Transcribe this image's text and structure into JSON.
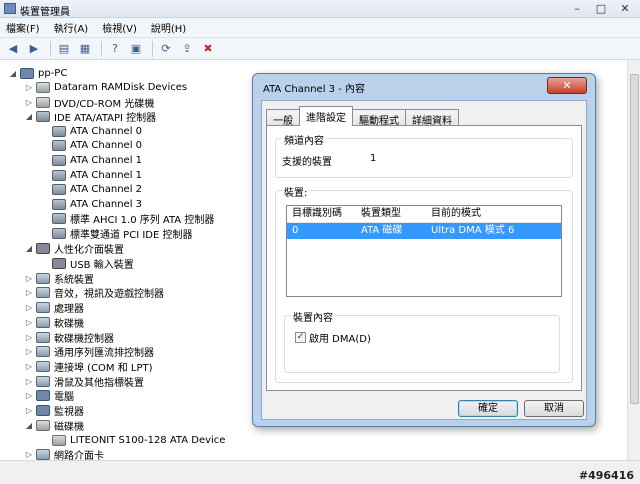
{
  "window": {
    "title": "裝置管理員",
    "controls": [
      "–",
      "□",
      "✕"
    ]
  },
  "menu": [
    "檔案(F)",
    "執行(A)",
    "檢視(V)",
    "說明(H)"
  ],
  "toolbar": {
    "icons": [
      "back-icon",
      "forward-icon",
      "view-icon",
      "properties-icon",
      "help-icon",
      "device-icon",
      "scan-icon",
      "update-driver-icon",
      "uninstall-icon"
    ]
  },
  "tree": {
    "root": "pp-PC",
    "items": [
      {
        "label": "Dataram RAMDisk Devices"
      },
      {
        "label": "DVD/CD-ROM 光碟機"
      },
      {
        "label": "IDE ATA/ATAPI 控制器"
      },
      {
        "label": "ATA Channel 0"
      },
      {
        "label": "ATA Channel 0"
      },
      {
        "label": "ATA Channel 1"
      },
      {
        "label": "ATA Channel 1"
      },
      {
        "label": "ATA Channel 2"
      },
      {
        "label": "ATA Channel 3"
      },
      {
        "label": "標準 AHCI 1.0 序列 ATA 控制器"
      },
      {
        "label": "標準雙通道 PCI IDE 控制器"
      },
      {
        "label": "人性化介面裝置"
      },
      {
        "label": "USB 輸入裝置"
      },
      {
        "label": "系統裝置"
      },
      {
        "label": "音效，視訊及遊戲控制器"
      },
      {
        "label": "處理器"
      },
      {
        "label": "軟碟機"
      },
      {
        "label": "軟碟機控制器"
      },
      {
        "label": "通用序列匯流排控制器"
      },
      {
        "label": "連接埠 (COM 和 LPT)"
      },
      {
        "label": "滑鼠及其他指標裝置"
      },
      {
        "label": "電腦"
      },
      {
        "label": "監視器"
      },
      {
        "label": "磁碟機"
      },
      {
        "label": "LITEONIT S100-128 ATA Device"
      },
      {
        "label": "網路介面卡"
      }
    ]
  },
  "dialog": {
    "title": "ATA Channel 3 - 內容",
    "close": "✕",
    "tabs": [
      "一般",
      "進階設定",
      "驅動程式",
      "詳細資料"
    ],
    "active_tab": "進階設定",
    "channel_group": {
      "label": "頻道內容",
      "field_label": "支援的裝置",
      "field_value": "1"
    },
    "device_group": {
      "label": "裝置:",
      "columns": [
        "目標識別碼",
        "裝置類型",
        "目前的模式"
      ],
      "rows": [
        [
          "0",
          "ATA 磁碟",
          "Ultra DMA 模式 6"
        ]
      ]
    },
    "device_props": {
      "label": "裝置內容",
      "checkbox_label": "啟用 DMA(D)",
      "checked": true
    },
    "ok": "確定",
    "cancel": "取消"
  },
  "watermark": "#496416"
}
